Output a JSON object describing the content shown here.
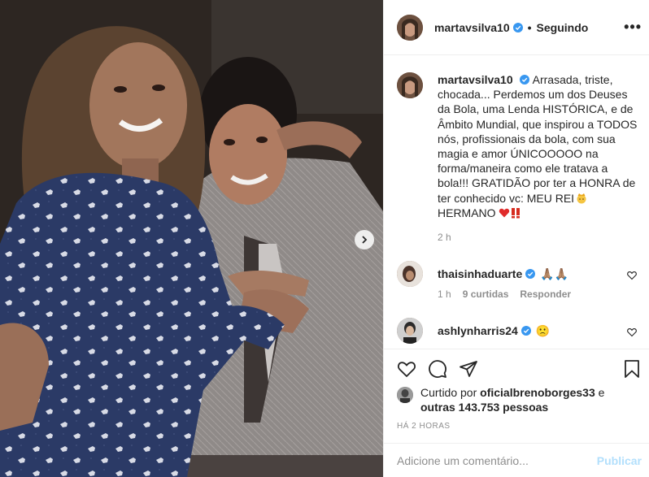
{
  "post": {
    "author": "martavsilva10",
    "follow_status": "Seguindo",
    "more_label": "•••",
    "caption_body": "Arrasada, triste, chocada... Perdemos um dos Deuses da Bola, uma Lenda HISTÓRICA, e de Âmbito Mundial, que inspirou a TODOS nós, profissionais da bola, com sua magia e amor ÚNICOOOOO na forma/maneira como ele tratava a bola!!! GRATIDÃO por ter a HONRA de ter conhecido vc: MEU REI",
    "caption_tail": "HERMANO",
    "caption_time": "2 h",
    "icons": {
      "verified": "verified-badge-icon",
      "next": "chevron-right-icon",
      "like": "heart-icon",
      "comment": "comment-bubble-icon",
      "share": "paper-plane-icon",
      "save": "bookmark-icon"
    }
  },
  "comments": [
    {
      "user": "thaisinhaduarte",
      "emoji": "🙏🏽🙏🏽",
      "time": "1 h",
      "likes": "9 curtidas",
      "reply": "Responder"
    },
    {
      "user": "ashlynharris24",
      "emoji": "🙁"
    }
  ],
  "likes": {
    "prefix": "Curtido por",
    "user": "oficialbrenoborges33",
    "mid": "e",
    "others": "outras 143.753 pessoas"
  },
  "time_ago": "HÁ 2 HORAS",
  "add_comment": {
    "placeholder": "Adicione um comentário...",
    "publish": "Publicar"
  },
  "colors": {
    "accent_blue": "#0095f6",
    "publish_disabled": "#b2dffc",
    "heart_red": "#ed4956",
    "muted": "#8e8e8e"
  }
}
